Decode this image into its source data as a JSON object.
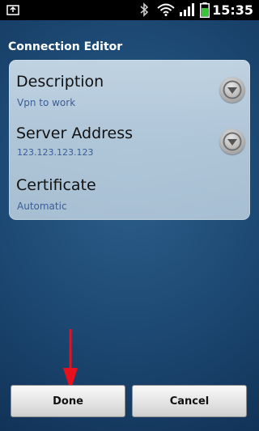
{
  "status_bar": {
    "time": "15:35",
    "icons": [
      "usb-icon",
      "bluetooth-icon",
      "wifi-icon",
      "signal-icon",
      "battery-icon"
    ]
  },
  "header": {
    "title": "Connection Editor"
  },
  "fields": [
    {
      "label": "Description",
      "value": "Vpn to work",
      "has_dropdown": true
    },
    {
      "label": "Server Address",
      "value": "123.123.123.123",
      "has_dropdown": true
    },
    {
      "label": "Certificate",
      "value": "Automatic",
      "has_dropdown": false
    }
  ],
  "buttons": {
    "done": "Done",
    "cancel": "Cancel"
  },
  "colors": {
    "status_bar": "#000000",
    "value_text": "#3a5d96",
    "annotation_arrow": "#e8101c"
  }
}
